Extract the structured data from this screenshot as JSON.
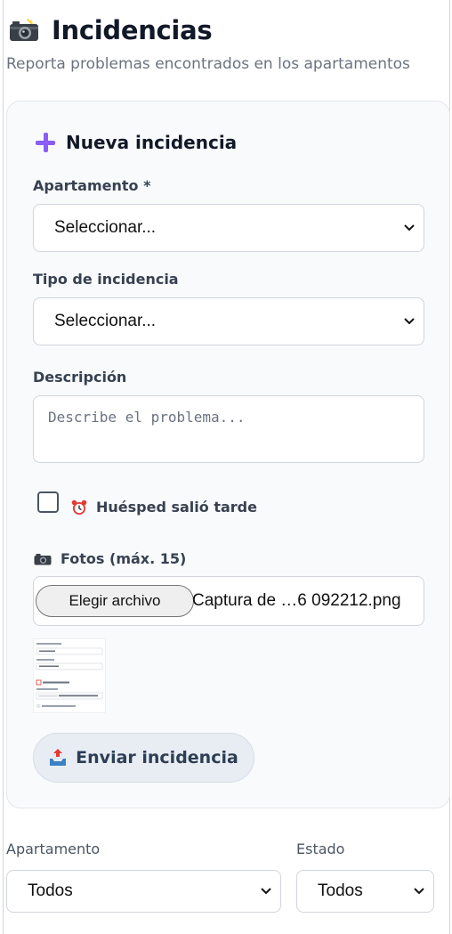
{
  "header": {
    "title": "Incidencias",
    "subtitle": "Reporta problemas encontrados en los apartamentos"
  },
  "form": {
    "heading": "Nueva incidencia",
    "apartment": {
      "label": "Apartamento *",
      "value": "Seleccionar..."
    },
    "type": {
      "label": "Tipo de incidencia",
      "value": "Seleccionar..."
    },
    "description": {
      "label": "Descripción",
      "placeholder": "Describe el problema..."
    },
    "late_checkout": {
      "label": "Huésped salió tarde",
      "checked": false
    },
    "photos": {
      "label": "Fotos (máx. 15)",
      "button_label": "Elegir archivo",
      "file_name": "Captura de …6 092212.png"
    },
    "submit_label": "Enviar incidencia"
  },
  "filters": {
    "apartment": {
      "label": "Apartamento",
      "value": "Todos"
    },
    "status": {
      "label": "Estado",
      "value": "Todos"
    }
  },
  "colors": {
    "accent": "#8b5cf6",
    "card_bg": "#f8fafc",
    "button_bg": "#e8edf3"
  },
  "icons": [
    "camera-icon",
    "plus-icon",
    "alarm-clock-icon",
    "inbox-upload-icon",
    "chevron-down-icon"
  ]
}
